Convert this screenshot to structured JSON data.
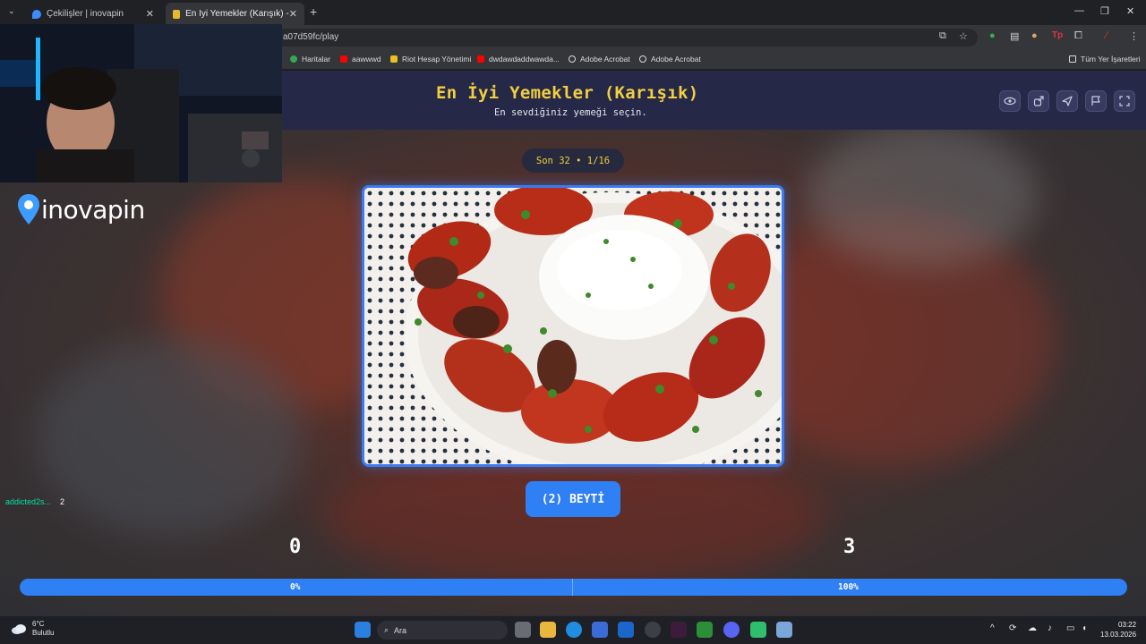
{
  "browser": {
    "tabs": [
      {
        "label": "Çekilişler | inovapin",
        "active": false
      },
      {
        "label": "En İyi Yemekler (Karışık) - Tier L",
        "active": true
      }
    ],
    "url": "a07d59fc/play",
    "bookmarks": [
      "Haritalar",
      "aawwwd",
      "Riot Hesap Yönetimi",
      "dwdawdaddwawda...",
      "Adobe Acrobat",
      "Adobe Acrobat"
    ],
    "all_bookmarks_label": "Tüm Yer İşaretleri"
  },
  "game": {
    "title": "En İyi Yemekler (Karışık)",
    "subtitle": "En sevdiğiniz yemeği seçin.",
    "round": "Son 32 • 1/16",
    "choice_label": "(2) BEYTİ",
    "left_score": "0",
    "right_score": "3",
    "left_pct": "0%",
    "right_pct": "100%",
    "right_share": 1.0,
    "header_icons": [
      "eye-icon",
      "share-icon",
      "send-icon",
      "flag-icon",
      "fullscreen-icon"
    ],
    "accent": "#2f7ff5",
    "title_color": "#f2cf3f"
  },
  "overlay": {
    "logo": "inovapin",
    "chat_user": "addicted2s...",
    "chat_msg": "2"
  },
  "taskbar": {
    "temp": "6°C",
    "weather": "Bulutlu",
    "search": "Ara",
    "time": "03:22",
    "date": "13.03.2026"
  }
}
